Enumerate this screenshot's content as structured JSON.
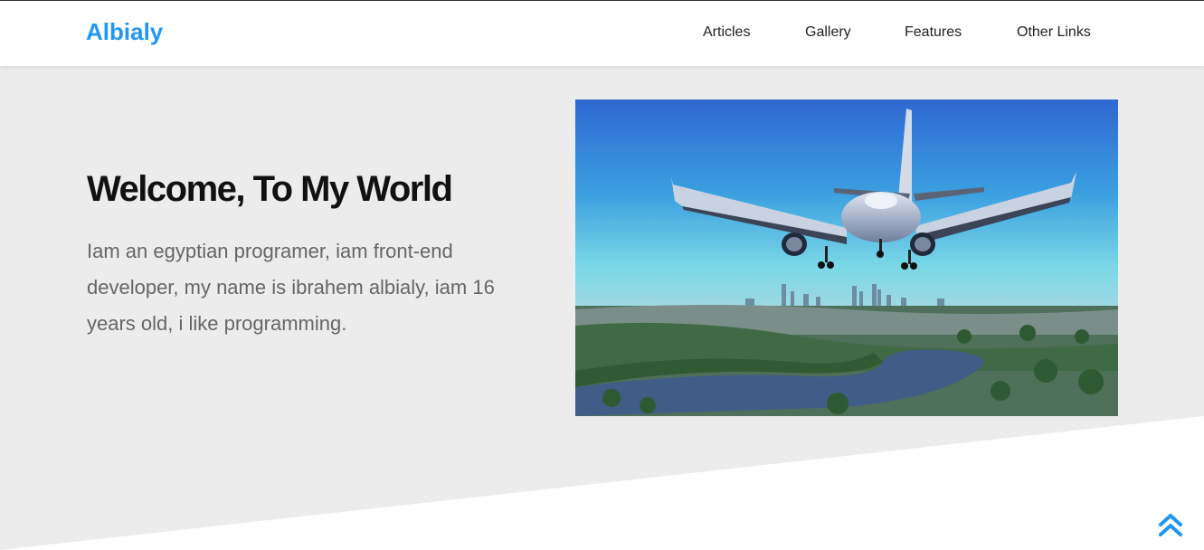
{
  "header": {
    "logo": "Albialy",
    "nav": [
      "Articles",
      "Gallery",
      "Features",
      "Other Links"
    ]
  },
  "landing": {
    "title": "Welcome, To My World",
    "text": "Iam an egyptian programer, iam front-end developer, my name is ibrahem albialy, iam 16 years old, i like programming."
  },
  "icons": {
    "scroll_top": "double-chevron-up-icon"
  },
  "colors": {
    "accent": "#2196f3",
    "landing_bg": "#ececec",
    "header_bg": "#ffffff",
    "title": "#111111",
    "body_text": "#666666"
  }
}
